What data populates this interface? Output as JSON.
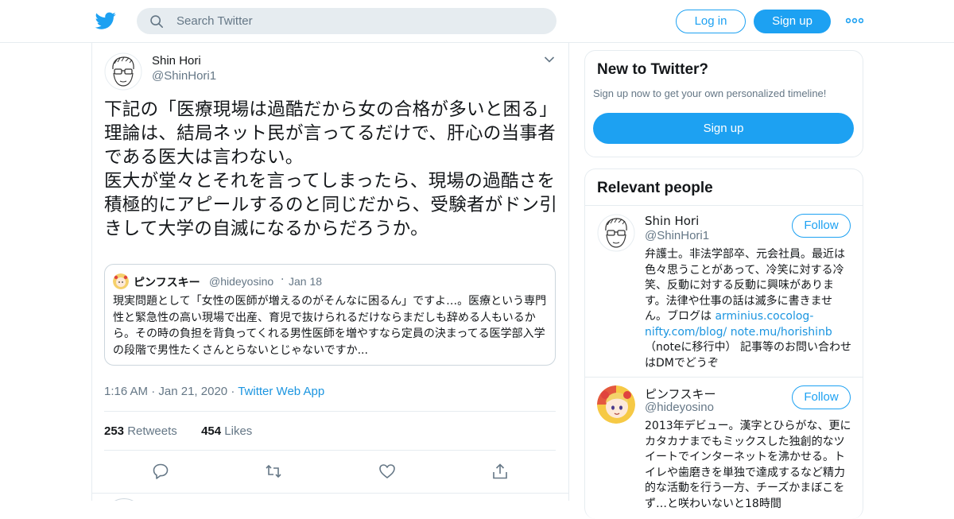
{
  "header": {
    "search_placeholder": "Search Twitter",
    "login_label": "Log in",
    "signup_label": "Sign up",
    "brand_color": "#1da1f2"
  },
  "tweet": {
    "author_name": "Shin Hori",
    "author_handle": "@ShinHori1",
    "text": "下記の「医療現場は過酷だから女の合格が多いと困る」理論は、結局ネット民が言ってるだけで、肝心の当事者である医大は言わない。\n医大が堂々とそれを言ってしまったら、現場の過酷さを積極的にアピールするのと同じだから、受験者がドン引きして大学の自滅になるからだろうか。",
    "quote": {
      "author_name": "ピンフスキー",
      "author_handle": "@hideyosino",
      "date": "Jan 18",
      "text": "現実問題として「女性の医師が増えるのがそんなに困るん」ですよ…。医療という専門性と緊急性の高い現場で出産、育児で抜けられるだけならまだしも辞める人もいるから。その時の負担を背負ってくれる男性医師を増やすなら定員の決まってる医学部入学の段階で男性たくさんとらないとじゃないですか..."
    },
    "time": "1:16 AM",
    "date": "Jan 21, 2020",
    "source": "Twitter Web App",
    "retweets_count": "253",
    "retweets_label": "Retweets",
    "likes_count": "454",
    "likes_label": "Likes"
  },
  "new_to_twitter": {
    "title": "New to Twitter?",
    "subtitle": "Sign up now to get your own personalized timeline!",
    "button_label": "Sign up"
  },
  "relevant_people": {
    "title": "Relevant people",
    "people": [
      {
        "name": "Shin Hori",
        "handle": "@ShinHori1",
        "follow_label": "Follow",
        "bio_text": "弁護士。非法学部卒、元会社員。最近は色々思うことがあって、冷笑に対する冷笑、反動に対する反動に興味があります。法律や仕事の話は滅多に書きません。ブログは ",
        "bio_link1": "arminius.cocolog-nifty.com/blog/",
        "bio_link2": "note.mu/horishinb",
        "bio_tail": "（noteに移行中） 記事等のお問い合わせはDMでどうぞ"
      },
      {
        "name": "ピンフスキー",
        "handle": "@hideyosino",
        "follow_label": "Follow",
        "bio_text": "2013年デビュー。漢字とひらがな、更にカタカナまでもミックスした独創的なツイートでインターネットを沸かせる。トイレや歯磨きを単独で達成するなど精力的な活動を行う一方、チーズかまぼこをず…と咲わいないと18時間"
      }
    ]
  }
}
